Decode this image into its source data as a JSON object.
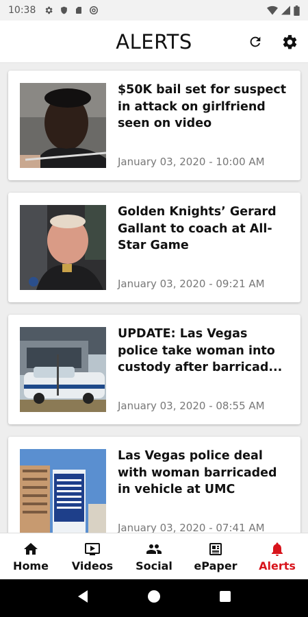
{
  "status_bar": {
    "time": "10:38"
  },
  "header": {
    "title": "ALERTS",
    "refresh_icon": "refresh-icon",
    "settings_icon": "gear-icon"
  },
  "alerts": [
    {
      "title": "$50K bail set for suspect in attack on girlfriend seen on video",
      "date": "January 03, 2020 - 10:00 AM"
    },
    {
      "title": "Golden Knights’ Gerard Gallant to coach at All-Star Game",
      "date": "January 03, 2020 - 09:21 AM"
    },
    {
      "title": "UPDATE: Las Vegas police take woman into custody after barricad...",
      "date": "January 03, 2020 - 08:55 AM"
    },
    {
      "title": "Las Vegas police deal with woman barricaded in vehicle at UMC",
      "date": "January 03, 2020 - 07:41 AM"
    }
  ],
  "bottom_nav": {
    "items": [
      {
        "label": "Home",
        "icon": "home-icon"
      },
      {
        "label": "Videos",
        "icon": "video-icon"
      },
      {
        "label": "Social",
        "icon": "people-icon"
      },
      {
        "label": "ePaper",
        "icon": "newspaper-icon"
      },
      {
        "label": "Alerts",
        "icon": "bell-icon"
      }
    ],
    "active": "Alerts"
  },
  "colors": {
    "accent": "#d8141c",
    "text": "#111111",
    "date": "#777777",
    "background": "#eeeeee"
  }
}
